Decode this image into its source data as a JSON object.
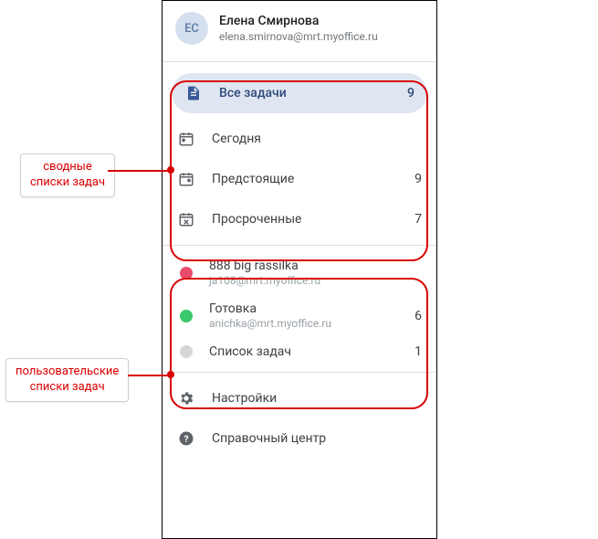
{
  "user": {
    "initials": "ЕС",
    "name": "Елена Смирнова",
    "email": "elena.smirnova@mrt.myoffice.ru"
  },
  "summary_lists": [
    {
      "label": "Все задачи",
      "count": "9",
      "active": true
    },
    {
      "label": "Сегодня",
      "count": ""
    },
    {
      "label": "Предстоящие",
      "count": "9"
    },
    {
      "label": "Просроченные",
      "count": "7"
    }
  ],
  "user_lists": [
    {
      "title": "888 big rassilka",
      "sub": "ja108@mrt.myoffice.ru",
      "count": "",
      "color": "#e84b6b"
    },
    {
      "title": "Готовка",
      "sub": "anichka@mrt.myoffice.ru",
      "count": "6",
      "color": "#3cc96b"
    },
    {
      "title": "Список задач",
      "sub": "",
      "count": "1",
      "color": "#d6d6d6"
    }
  ],
  "footer": {
    "settings": "Настройки",
    "help": "Справочный центр"
  },
  "callouts": {
    "summary": "сводные\nсписки задач",
    "user": "пользовательские\nсписки задач"
  }
}
